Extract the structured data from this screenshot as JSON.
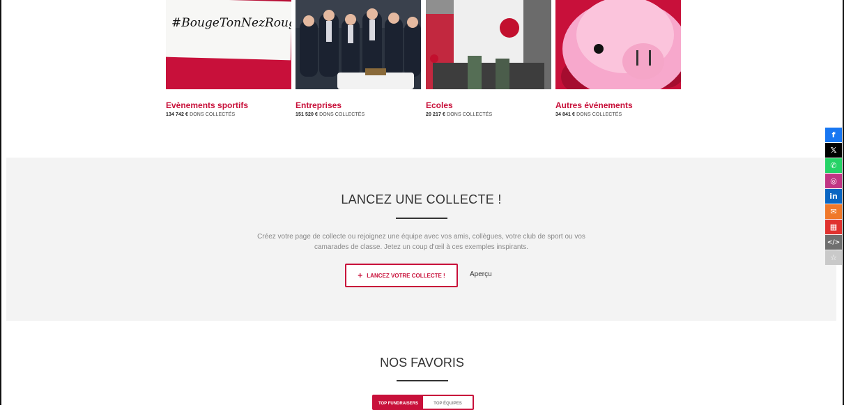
{
  "categories": [
    {
      "title": "Evènements sportifs",
      "amount": "134 742 €",
      "suffix": "DONS COLLECTÉS",
      "sign_text": "#BougeTonNezRouge"
    },
    {
      "title": "Entreprises",
      "amount": "151 520 €",
      "suffix": "DONS COLLECTÉS"
    },
    {
      "title": "Ecoles",
      "amount": "20 217 €",
      "suffix": "DONS COLLECTÉS"
    },
    {
      "title": "Autres événements",
      "amount": "34 841 €",
      "suffix": "DONS COLLECTÉS"
    }
  ],
  "collect": {
    "heading": "LANCEZ UNE COLLECTE !",
    "description": "Créez votre page de collecte ou rejoignez une équipe avec vos amis, collègues, votre club de sport ou vos camarades de classe. Jetez un coup d'œil à ces exemples inspirants.",
    "button_label": "LANCEZ VOTRE COLLECTE !",
    "button_icon": "+",
    "preview_label": "Aperçu"
  },
  "favorites": {
    "heading": "NOS FAVORIS",
    "tabs": [
      "TOP FUNDRAISERS",
      "TOP ÉQUIPES"
    ]
  },
  "share": [
    {
      "icon": "facebook-icon",
      "glyph": "f",
      "color": "#1877f2"
    },
    {
      "icon": "x-icon",
      "glyph": "𝕏",
      "color": "#000000"
    },
    {
      "icon": "whatsapp-icon",
      "glyph": "✆",
      "color": "#25d366"
    },
    {
      "icon": "instagram-icon",
      "glyph": "◎",
      "color": "#c13584"
    },
    {
      "icon": "linkedin-icon",
      "glyph": "in",
      "color": "#0a66c2"
    },
    {
      "icon": "email-icon",
      "glyph": "✉",
      "color": "#f0782a"
    },
    {
      "icon": "qrcode-icon",
      "glyph": "▦",
      "color": "#e0322f"
    },
    {
      "icon": "embed-icon",
      "glyph": "</>",
      "color": "#6f6f6f"
    },
    {
      "icon": "star-icon",
      "glyph": "☆",
      "color": "#c9c9c9"
    }
  ],
  "colors": {
    "accent": "#c8103a",
    "section_bg": "#f3f3f3"
  }
}
